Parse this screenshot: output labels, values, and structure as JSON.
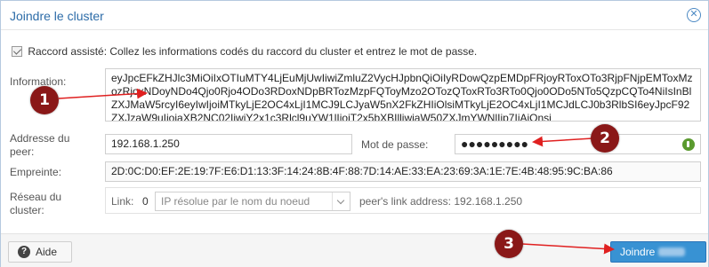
{
  "dialog": {
    "title": "Joindre le cluster",
    "close_icon": "close-icon",
    "assist_label": "Raccord assisté: Collez les informations codés du raccord du cluster et entrez le mot de passe.",
    "assist_checked": true
  },
  "fields": {
    "information_label": "Information:",
    "information_value": "eyJpcEFkZHJlc3MiOiIxOTIuMTY4LjEuMjUwIiwiZmluZ2VycHJpbnQiOiIyRDowQzpEMDpFRjoyRToxOTo3RjpFNjpEMToxMzozRjoxNDoyNDo4Qjo0Rjo4ODo3RDoxNDpBRTozMzpFQToyMzo2OTozQToxRTo3RTo0Qjo0ODo5NTo5QzpCQTo4NiIsInBlZXJMaW5rcyI6eyIwIjoiMTkyLjE2OC4xLjI1MCJ9LCJyaW5nX2FkZHIiOlsiMTkyLjE2OC4xLjI1MCJdLCJ0b3RlbSI6eyJpcF92ZXJzaW9uIjoiaXB2NC02IiwiY2x1c3Rlcl9uYW1lIjoiT2x5bXBIlliwiaW50ZXJmYWNlIjp7IjAiOnsi",
    "peer_label": "Addresse du peer:",
    "peer_value": "192.168.1.250",
    "password_label": "Mot de passe:",
    "password_value": "●●●●●●●●●",
    "fingerprint_label": "Empreinte:",
    "fingerprint_value": "2D:0C:D0:EF:2E:19:7F:E6:D1:13:3F:14:24:8B:4F:88:7D:14:AE:33:EA:23:69:3A:1E:7E:4B:48:95:9C:BA:86",
    "network_label": "Réseau du cluster:",
    "link_label": "Link:",
    "link_number": "0",
    "link_select_placeholder": "IP résolue par le nom du noeud",
    "peer_link_text": "peer's link address: 192.168.1.250"
  },
  "footer": {
    "help_label": "Aide",
    "join_label": "Joindre"
  },
  "annotations": [
    "1",
    "2",
    "3"
  ],
  "colors": {
    "title": "#2d6ca8",
    "annotation_circle": "#8a1818",
    "arrow": "#e02020",
    "join_button": "#3892d3"
  }
}
